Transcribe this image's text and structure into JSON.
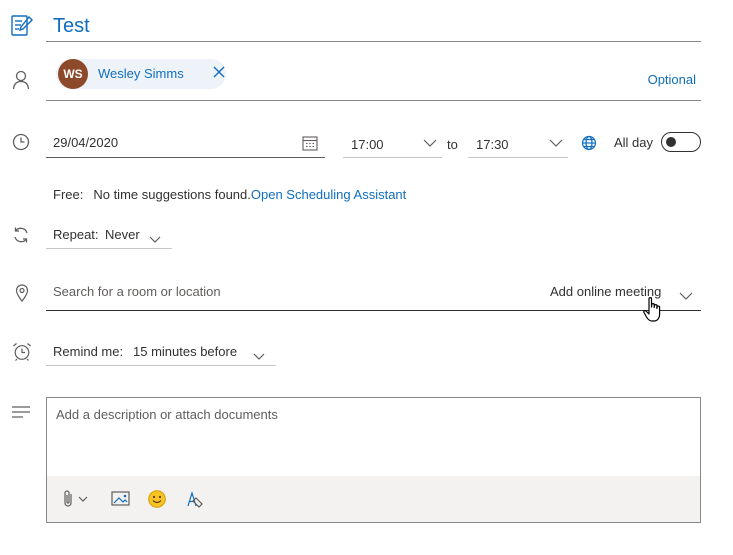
{
  "event": {
    "title": "Test"
  },
  "attendees": {
    "chips": [
      {
        "initials": "WS",
        "name": "Wesley Simms"
      }
    ],
    "optional_label": "Optional"
  },
  "schedule": {
    "date": "29/04/2020",
    "start_time": "17:00",
    "to_label": "to",
    "end_time": "17:30",
    "all_day_label": "All day",
    "all_day_on": false
  },
  "availability": {
    "free_label": "Free:",
    "message": "No time suggestions found.",
    "link": "Open Scheduling Assistant"
  },
  "repeat": {
    "label": "Repeat:",
    "value": "Never"
  },
  "location": {
    "placeholder": "Search for a room or location",
    "online_meeting_label": "Add online meeting"
  },
  "reminder": {
    "label": "Remind me:",
    "value": "15 minutes before"
  },
  "description": {
    "placeholder": "Add a description or attach documents",
    "toolbar": [
      "paperclip-icon",
      "image-icon",
      "emoji-icon",
      "format-paint-icon"
    ]
  },
  "colors": {
    "accent": "#106ebe",
    "icon": "#605e5c",
    "avatar": "#8d4a2a",
    "chip_bg": "#eef3f9"
  }
}
